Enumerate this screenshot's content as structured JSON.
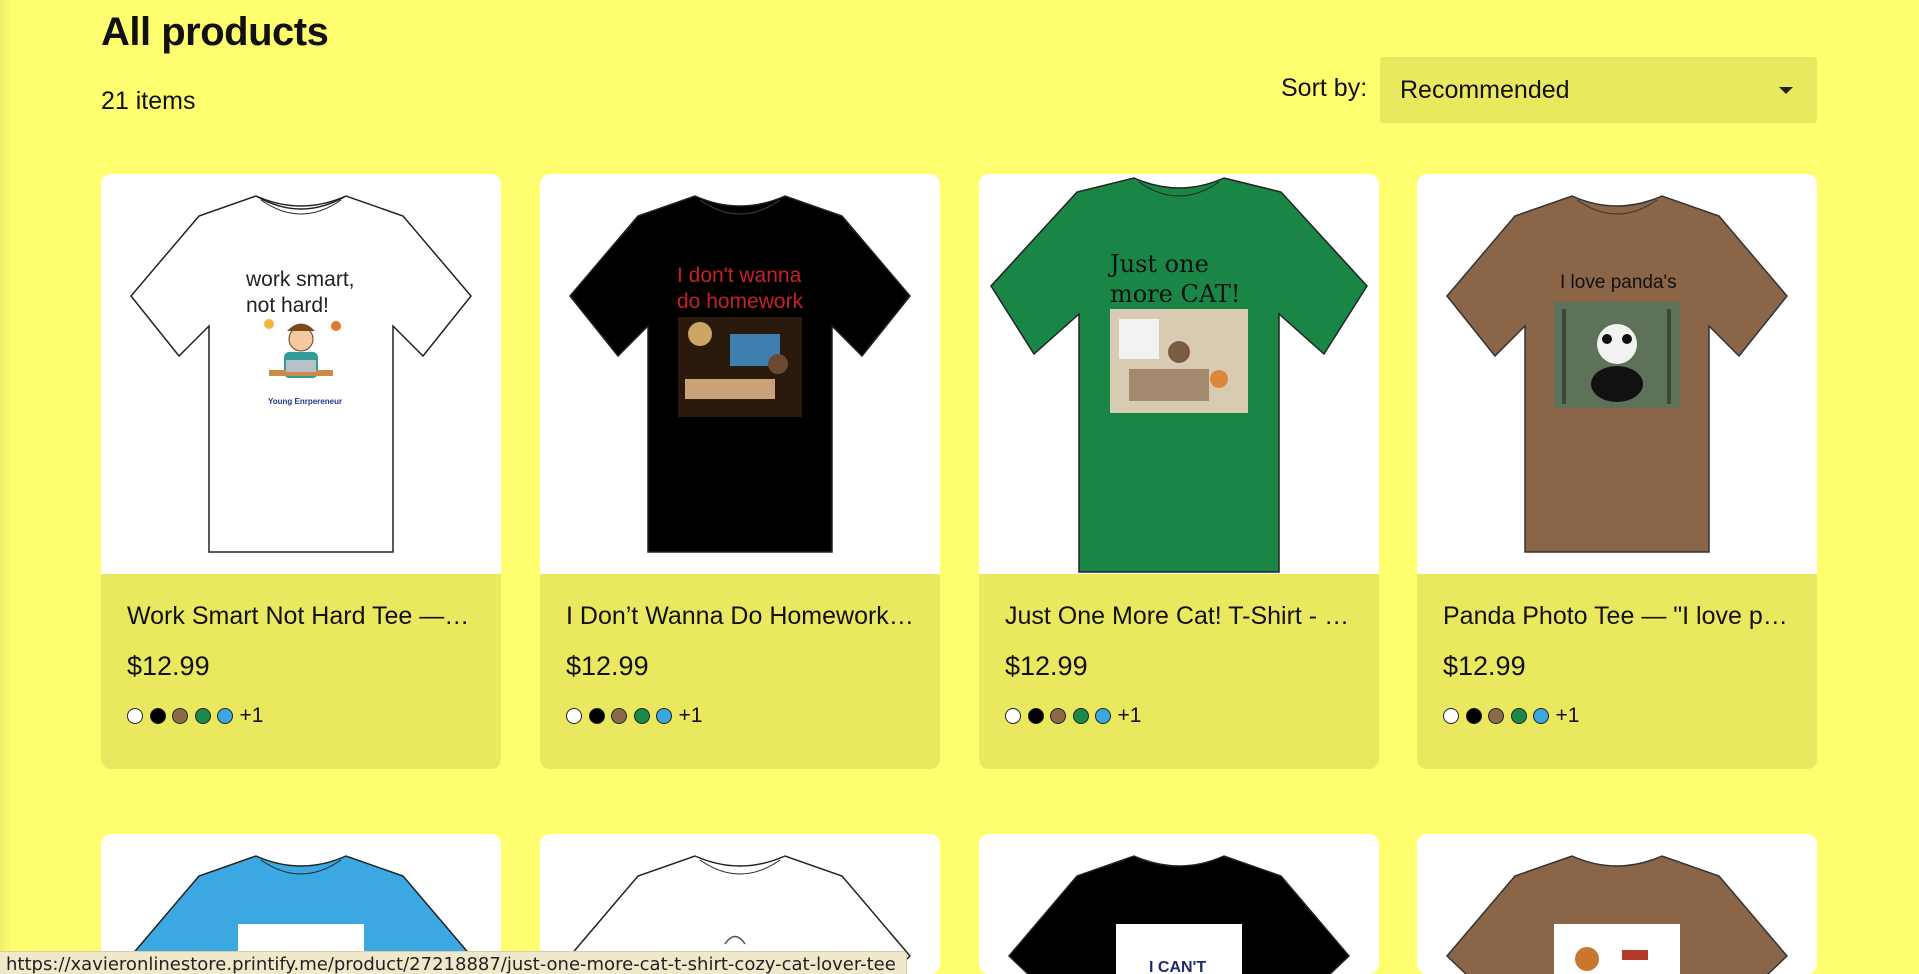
{
  "header": {
    "title": "All products",
    "item_count": "21 items",
    "sort_label": "Sort by:",
    "sort_value": "Recommended"
  },
  "colors": {
    "page_bg": "#fefe6e",
    "card_info_bg": "#e9e85f",
    "swatches": [
      "#ffffff",
      "#000000",
      "#8b6a4a",
      "#1c8a46",
      "#3aa7e0"
    ]
  },
  "products": [
    {
      "title": "Work Smart Not Hard Tee — …",
      "price": "$12.99",
      "more_colors": "+1",
      "shirt_color": "#ffffff",
      "print_text": [
        "work smart,",
        "not hard!"
      ],
      "print_caption": "Young Enrpereneur",
      "print_text_color": "#222222"
    },
    {
      "title": "I Don’t Wanna Do Homework …",
      "price": "$12.99",
      "more_colors": "+1",
      "shirt_color": "#000000",
      "print_text": [
        "I don't wanna",
        "do homework"
      ],
      "print_text_color": "#c7202b"
    },
    {
      "title": "Just One More Cat! T-Shirt - …",
      "price": "$12.99",
      "more_colors": "+1",
      "shirt_color": "#1a8646",
      "print_text": [
        "Just one",
        "more CAT!"
      ],
      "print_text_color": "#111111"
    },
    {
      "title": "Panda Photo Tee — \"I love pa…",
      "price": "$12.99",
      "more_colors": "+1",
      "shirt_color": "#8b6547",
      "print_text": [
        "I love panda's"
      ],
      "print_text_color": "#111111"
    }
  ],
  "products_row2": [
    {
      "shirt_color": "#3ba8e2",
      "print_text": []
    },
    {
      "shirt_color": "#ffffff",
      "print_text": []
    },
    {
      "shirt_color": "#000000",
      "print_text": [
        "I CAN'T"
      ]
    },
    {
      "shirt_color": "#8b6547",
      "print_text": []
    }
  ],
  "status_bar": {
    "url": "https://xavieronlinestore.printify.me/product/27218887/just-one-more-cat-t-shirt-cozy-cat-lover-tee"
  }
}
